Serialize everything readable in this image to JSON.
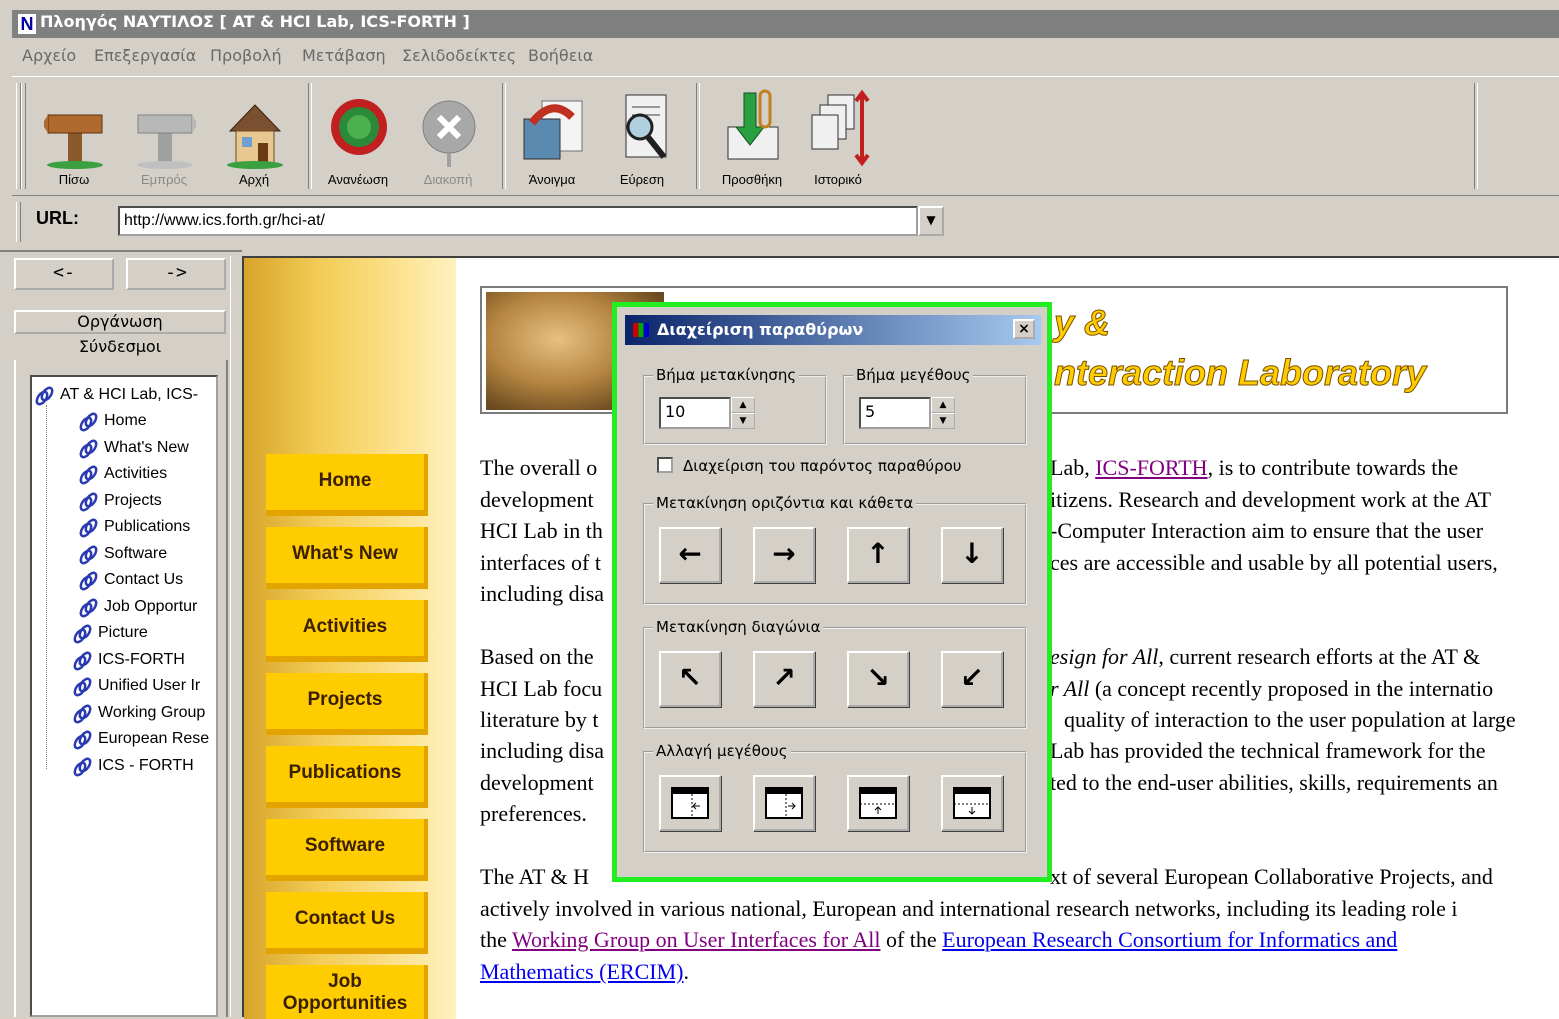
{
  "window": {
    "title": "Πλοηγός ΝΑΥΤΙΛΟΣ [ AT & HCI Lab, ICS-FORTH ]",
    "logo_letter": "N"
  },
  "menu": [
    "Αρχείο",
    "Επεξεργασία",
    "Προβολή",
    "Μετάβαση",
    "Σελιδοδείκτες",
    "Βοήθεια"
  ],
  "toolbar": {
    "back": "Πίσω",
    "forward": "Εμπρός",
    "home": "Αρχή",
    "reload": "Ανανέωση",
    "stop": "Διακοπή",
    "open": "Άνοιγμα",
    "find": "Εύρεση",
    "add": "Προσθήκη",
    "history": "Ιστορικό"
  },
  "url": {
    "label": "URL:",
    "value": "http://www.ics.forth.gr/hci-at/"
  },
  "left_panel": {
    "back_arrow": "<-",
    "forward_arrow": "->",
    "tab_organize": "Οργάνωση",
    "tab_links": "Σύνδεσμοι",
    "tree": [
      "AT & HCI Lab, ICS-",
      "Home",
      "What's New",
      "Activities",
      "Projects",
      "Publications",
      "Software",
      "Contact Us",
      "Job Opportur",
      "Picture",
      "ICS-FORTH",
      "Unified User Ir",
      "Working Group",
      "European Rese",
      "ICS - FORTH"
    ]
  },
  "site_nav": [
    "Home",
    "What's New",
    "Activities",
    "Projects",
    "Publications",
    "Software",
    "Contact Us",
    "Job Opportunities"
  ],
  "banner": {
    "line1": "y &",
    "line2": "nteraction Laboratory"
  },
  "content": {
    "p1": {
      "l1a": "The overall o",
      "l1b": "Lab, ",
      "l1link": "ICS-FORTH",
      "l1c": ", is to contribute towards the",
      "l2a": "development",
      "l2b": "itizens. Research and development work at the AT",
      "l3a": "HCI Lab in th",
      "l3b": "-Computer Interaction aim to ensure that the user",
      "l4a": "interfaces of t",
      "l4b": "ces are accessible and usable by all potential users,",
      "l5a": "including disa"
    },
    "p2": {
      "l1a": "Based on the",
      "l1b": "esign for All",
      "l1c": ", current research efforts at the AT &",
      "l2a": "HCI Lab focu",
      "l2b": "r All",
      "l2c": " (a concept recently proposed in the internatio",
      "l3a": "literature by t",
      "l3b": "quality of interaction to the user population at large",
      "l4a": "including disa",
      "l4b": "Lab has provided the technical framework for the",
      "l5a": "development",
      "l5b": "ted to the end-user abilities, skills, requirements an",
      "l6a": "preferences."
    },
    "p3": {
      "l1a": "The AT & H",
      "l1b": "xt of several European Collaborative Projects, and",
      "l2": "actively involved in various national, European and international research networks, including its leading role i",
      "l3a": "the ",
      "l3link1": "Working Group on User Interfaces for All",
      "l3b": " of the ",
      "l3link2": "European Research Consortium for Informatics and",
      "l4link": "Mathematics (ERCIM)",
      "l4b": "."
    }
  },
  "dialog": {
    "title": "Διαχείριση παραθύρων",
    "close": "×",
    "move_step_label": "Βήμα μετακίνησης",
    "move_step_value": "10",
    "size_step_label": "Βήμα μεγέθους",
    "size_step_value": "5",
    "manage_current": "Διαχείριση του παρόντος παραθύρου",
    "manage_current_checked": false,
    "move_hv_label": "Μετακίνηση οριζόντια και κάθετα",
    "move_diag_label": "Μετακίνηση διαγώνια",
    "resize_label": "Αλλαγή μεγέθους",
    "arrows_hv": [
      "←",
      "→",
      "↑",
      "↓"
    ],
    "arrows_diag": [
      "↖",
      "↗",
      "↘",
      "↙"
    ]
  },
  "colors": {
    "dialog_highlight": "#22ee22",
    "nav_button": "#ffcc00",
    "link": "#0000ee",
    "visited_link": "#800080"
  }
}
